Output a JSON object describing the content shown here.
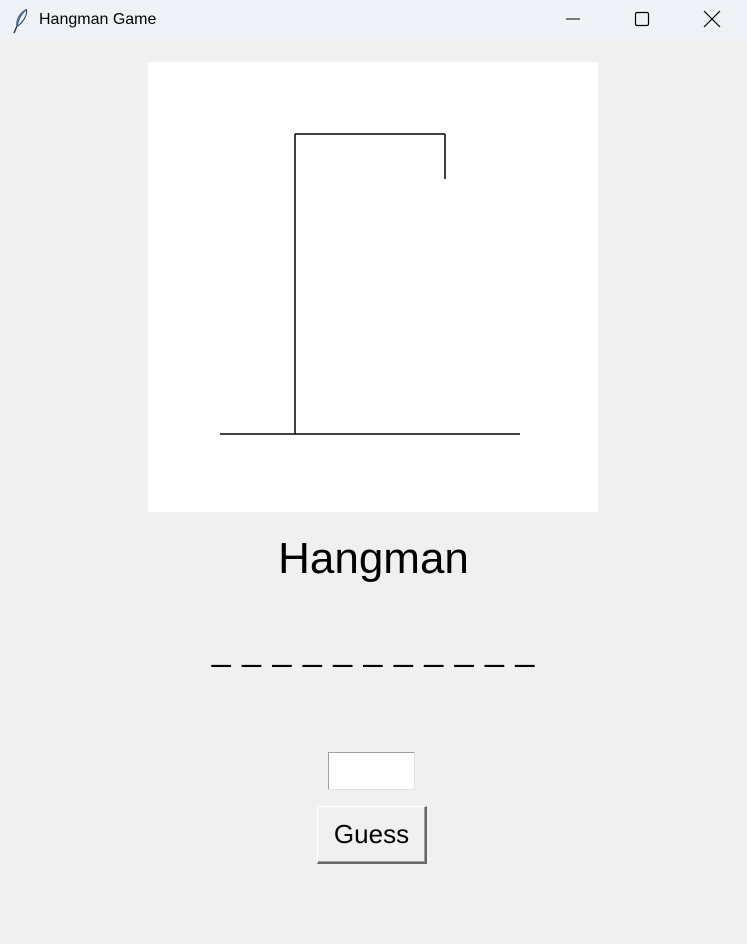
{
  "window": {
    "title": "Hangman Game",
    "app_icon": "feather-icon",
    "controls": {
      "minimize_icon": "minimize-icon",
      "maximize_icon": "maximize-icon",
      "close_icon": "close-icon"
    }
  },
  "game": {
    "heading": "Hangman",
    "masked_word": "_ _ _ _ _ _ _ _ _ _ _",
    "guess_input_value": "",
    "guess_button_label": "Guess",
    "gallows_parts": [
      "base",
      "pole",
      "beam",
      "rope"
    ]
  },
  "colors": {
    "background": "#f0f0f0",
    "canvas": "#ffffff",
    "titlebar": "#eff2f6",
    "stroke": "#000000"
  }
}
